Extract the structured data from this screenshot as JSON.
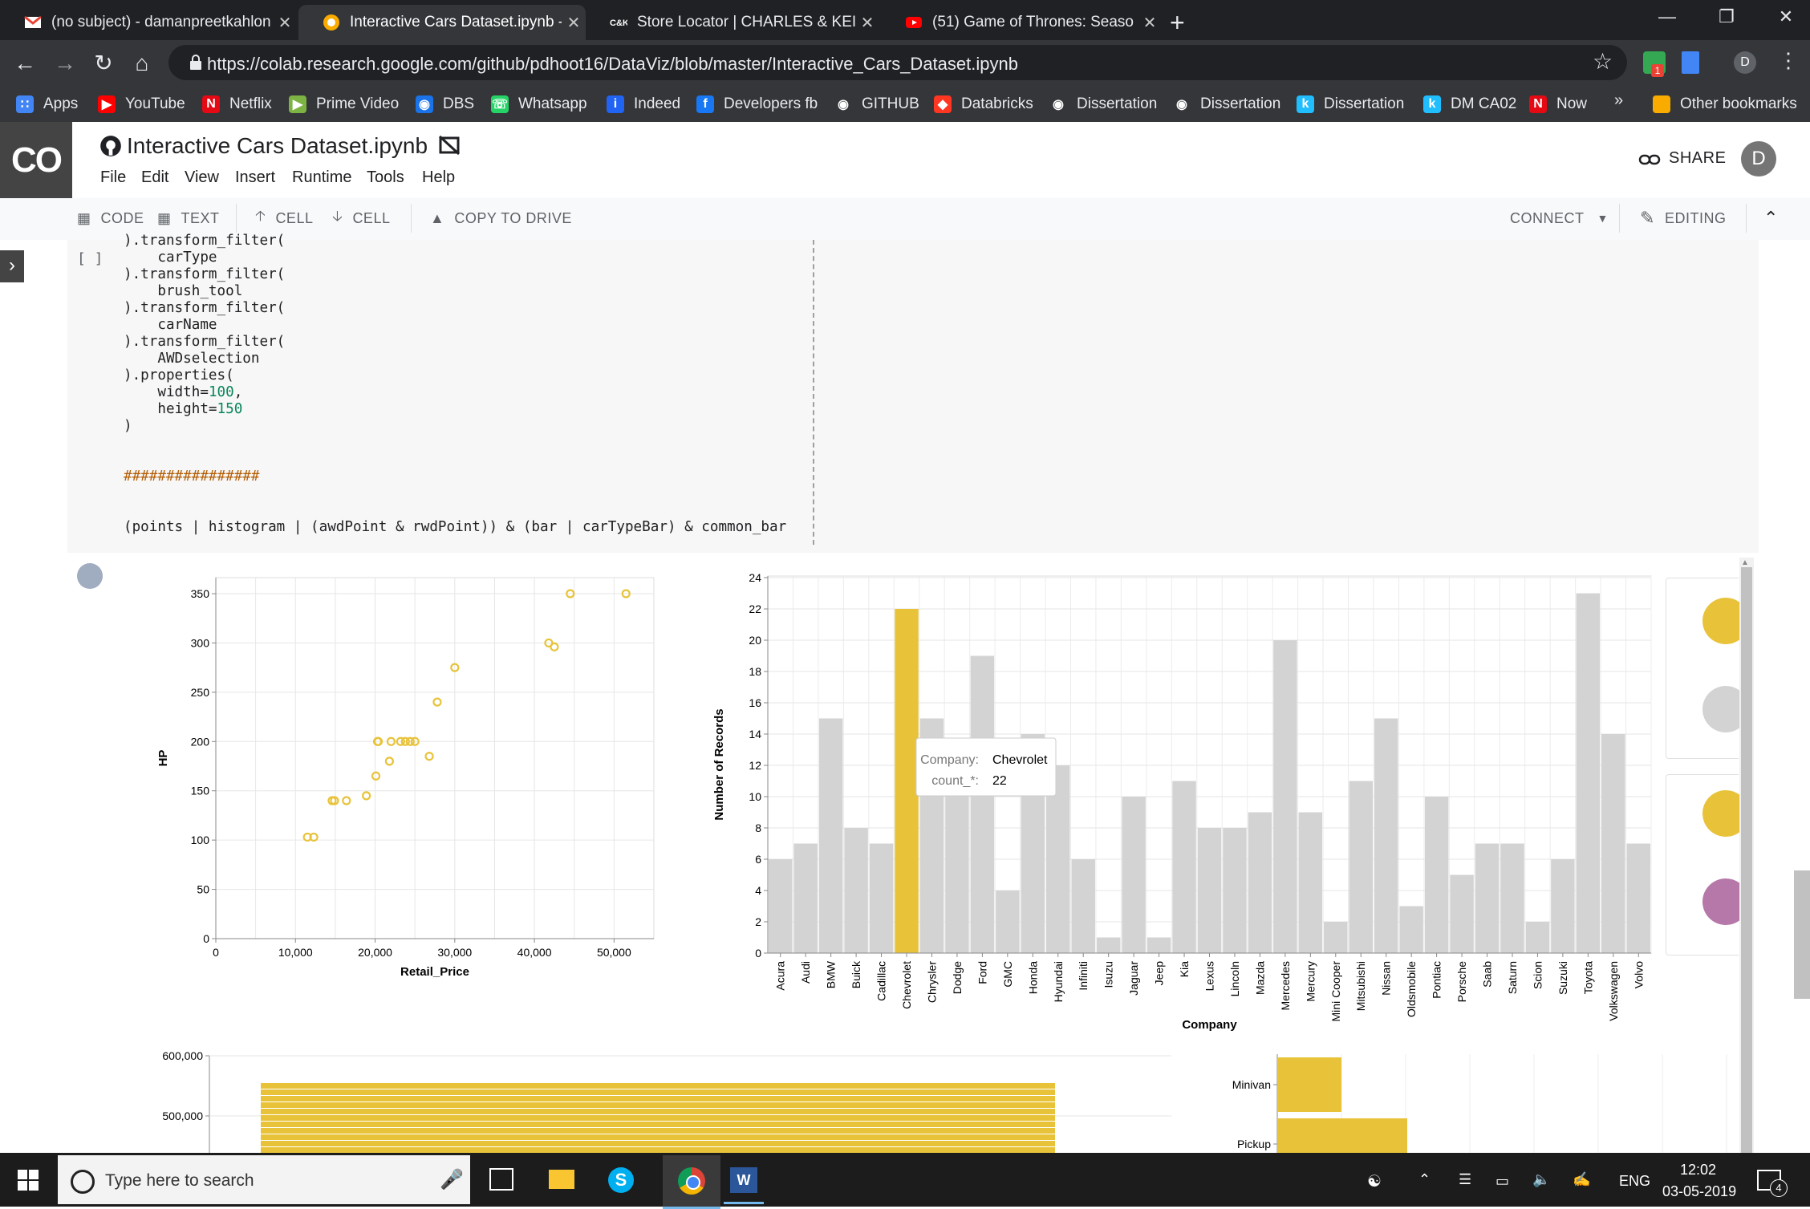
{
  "browser": {
    "tabs": [
      {
        "title": "(no subject) - damanpreetkahlon",
        "icon": "gmail-icon",
        "active": false
      },
      {
        "title": "Interactive Cars Dataset.ipynb - C",
        "icon": "colab-icon",
        "active": true
      },
      {
        "title": "Store Locator | CHARLES & KEITH",
        "icon": "charles-keith-icon",
        "active": false
      },
      {
        "title": "(51) Game of Thrones: Seaso",
        "icon": "youtube-icon",
        "active": false
      }
    ],
    "new_tab": "+",
    "url": "https://colab.research.google.com/github/pdhoot16/DataViz/blob/master/Interactive_Cars_Dataset.ipynb",
    "profile_initial": "D",
    "bookmarks": [
      {
        "label": "Apps",
        "icon": "apps-grid-icon"
      },
      {
        "label": "YouTube",
        "icon": "youtube-icon"
      },
      {
        "label": "Netflix",
        "icon": "netflix-icon"
      },
      {
        "label": "Prime Video",
        "icon": "prime-video-icon"
      },
      {
        "label": "DBS",
        "icon": "globe-icon"
      },
      {
        "label": "Whatsapp",
        "icon": "whatsapp-icon"
      },
      {
        "label": "Indeed",
        "icon": "indeed-icon"
      },
      {
        "label": "Developers fb",
        "icon": "facebook-icon"
      },
      {
        "label": "GITHUB",
        "icon": "github-icon"
      },
      {
        "label": "Databricks",
        "icon": "databricks-icon"
      },
      {
        "label": "Dissertation",
        "icon": "github-icon"
      },
      {
        "label": "Dissertation",
        "icon": "github-icon"
      },
      {
        "label": "Dissertation",
        "icon": "kaggle-icon"
      },
      {
        "label": "DM CA02",
        "icon": "kaggle-icon"
      },
      {
        "label": "Now",
        "icon": "netflix-icon"
      }
    ],
    "bookmarks_more": "»",
    "other_bookmarks": "Other bookmarks"
  },
  "colab": {
    "logo": "CO",
    "notebook_title": "Interactive Cars Dataset.ipynb",
    "menu": [
      "File",
      "Edit",
      "View",
      "Insert",
      "Runtime",
      "Tools",
      "Help"
    ],
    "share": "SHARE",
    "user_initial": "D",
    "toolbar": {
      "code": "CODE",
      "text": "TEXT",
      "cell_up": "CELL",
      "cell_down": "CELL",
      "copy_to_drive": "COPY TO DRIVE",
      "connect": "CONNECT",
      "editing": "EDITING"
    },
    "cell_run_indicator": "[ ]",
    "code_lines": [
      ").transform_filter(",
      "    carType",
      ").transform_filter(",
      "    brush_tool",
      ").transform_filter(",
      "    carName",
      ").transform_filter(",
      "    AWDselection",
      ").properties(",
      "    width=100,",
      "    height=150",
      ")",
      "",
      "",
      "################",
      "",
      "",
      "(points | histogram | (awdPoint & rwdPoint)) & (bar | carTypeBar) & common_bar"
    ]
  },
  "chart_data": [
    {
      "type": "scatter",
      "xlabel": "Retail_Price",
      "ylabel": "HP",
      "xlim": [
        0,
        55000
      ],
      "ylim": [
        0,
        350
      ],
      "x_ticks": [
        "0",
        "10,000",
        "20,000",
        "30,000",
        "40,000",
        "50,000"
      ],
      "y_ticks": [
        "0",
        "50",
        "100",
        "150",
        "200",
        "250",
        "300",
        "350"
      ],
      "color": "#e8c33a",
      "grid": true,
      "points": [
        {
          "x": 11500,
          "y": 103
        },
        {
          "x": 12300,
          "y": 103
        },
        {
          "x": 14600,
          "y": 140
        },
        {
          "x": 14900,
          "y": 140
        },
        {
          "x": 16400,
          "y": 140
        },
        {
          "x": 18900,
          "y": 145
        },
        {
          "x": 20100,
          "y": 165
        },
        {
          "x": 20300,
          "y": 200
        },
        {
          "x": 20400,
          "y": 200
        },
        {
          "x": 21800,
          "y": 180
        },
        {
          "x": 22000,
          "y": 200
        },
        {
          "x": 23200,
          "y": 200
        },
        {
          "x": 23800,
          "y": 200
        },
        {
          "x": 24400,
          "y": 200
        },
        {
          "x": 25000,
          "y": 200
        },
        {
          "x": 26800,
          "y": 185
        },
        {
          "x": 27800,
          "y": 240
        },
        {
          "x": 30000,
          "y": 275
        },
        {
          "x": 41800,
          "y": 300
        },
        {
          "x": 42500,
          "y": 296
        },
        {
          "x": 44500,
          "y": 350
        },
        {
          "x": 51500,
          "y": 350
        }
      ]
    },
    {
      "type": "bar",
      "xlabel": "Company",
      "ylabel": "Number of Records",
      "ylim": [
        0,
        24
      ],
      "y_ticks": [
        "0",
        "2",
        "4",
        "6",
        "8",
        "10",
        "12",
        "14",
        "16",
        "18",
        "20",
        "22",
        "24"
      ],
      "grid": true,
      "categories": [
        "Acura",
        "Audi",
        "BMW",
        "Buick",
        "Cadillac",
        "Chevrolet",
        "Chrysler",
        "Dodge",
        "Ford",
        "GMC",
        "Honda",
        "Hyundai",
        "Infiniti",
        "Isuzu",
        "Jaguar",
        "Jeep",
        "Kia",
        "Lexus",
        "Lincoln",
        "Mazda",
        "Mercedes",
        "Mercury",
        "Mini Cooper",
        "Mitsubishi",
        "Nissan",
        "Oldsmobile",
        "Pontiac",
        "Porsche",
        "Saab",
        "Saturn",
        "Scion",
        "Suzuki",
        "Toyota",
        "Volkswagen",
        "Volvo"
      ],
      "values": [
        6,
        7,
        15,
        8,
        7,
        22,
        15,
        11,
        19,
        4,
        14,
        12,
        6,
        1,
        10,
        1,
        11,
        8,
        8,
        9,
        20,
        9,
        2,
        11,
        15,
        3,
        10,
        5,
        7,
        7,
        2,
        6,
        23,
        14,
        7
      ],
      "highlight": "Chevrolet",
      "highlight_color": "#e8c33a",
      "base_color": "#d3d3d3",
      "tooltip": {
        "company_label": "Company:",
        "company_value": "Chevrolet",
        "count_label": "count_*:",
        "count_value": "22"
      }
    },
    {
      "type": "bar",
      "y_ticks": [
        "500,000",
        "600,000"
      ],
      "note": "partially visible",
      "color": "#e8c33a"
    },
    {
      "type": "bar",
      "categories": [
        "Minivan",
        "Pickup"
      ],
      "color": "#e8c33a",
      "note": "partially visible"
    }
  ],
  "legend_swatches": [
    "#e8c33a",
    "#d3d3d3",
    "#e8c33a",
    "#b678a8"
  ],
  "taskbar": {
    "search_placeholder": "Type here to search",
    "language": "ENG",
    "time": "12:02",
    "date": "03-05-2019",
    "notifications": "4"
  }
}
